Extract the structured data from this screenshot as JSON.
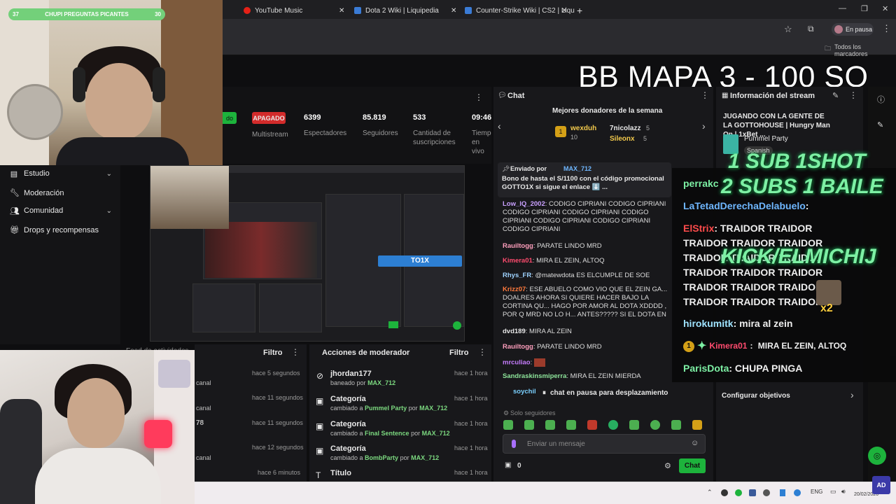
{
  "poll": {
    "left_count": "37",
    "title": "CHUPI PREGUNTAS PICANTES",
    "right_count": "30"
  },
  "browser": {
    "tabs": [
      {
        "label": "YouTube Music"
      },
      {
        "label": "Dota 2 Wiki | Liquipedia"
      },
      {
        "label": "Counter-Strike Wiki | CS2 | Liqu"
      }
    ],
    "profile_status": "En pausa",
    "bookmarks_label": "Todos los marcadores"
  },
  "overlay": {
    "headline": "BB MAPA 3 - 100 SO",
    "promo_line1": "1 SUB 1SHOT",
    "promo_line2": "2 SUBS 1 BAILE",
    "promo_kick": "KICK/ELMICHIJ",
    "multiplier": "x2"
  },
  "stats": {
    "status_partial": "do",
    "apagado_label": "APAGADO",
    "multistream_label": "Multistream",
    "items": [
      {
        "value": "6399",
        "label": "Espectadores"
      },
      {
        "value": "85.819",
        "label": "Seguidores"
      },
      {
        "value": "533",
        "label": "Cantidad de suscripciones"
      },
      {
        "value": "09:46",
        "label": "Tiempo en vivo"
      }
    ]
  },
  "sidebar": {
    "items": [
      {
        "label": "Estudio"
      },
      {
        "label": "Moderación"
      },
      {
        "label": "Comunidad"
      },
      {
        "label": "Drops y recompensas"
      }
    ]
  },
  "activity_panel": {
    "title": "Feed de actividades",
    "filter": "Filtro",
    "rows": [
      {
        "sub": "canal",
        "time": "hace 5 segundos"
      },
      {
        "sub": "canal",
        "time": "hace 11 segundos"
      },
      {
        "sub": "78",
        "time": "hace 11 segundos"
      },
      {
        "sub": "canal",
        "time": "hace 12 segundos"
      },
      {
        "sub": "canal",
        "time": "hace 6 minutos"
      }
    ]
  },
  "mod_panel": {
    "title": "Acciones de moderador",
    "filter": "Filtro",
    "rows": [
      {
        "title": "jhordan177",
        "verb": "baneado por",
        "value": "",
        "by": "MAX_712",
        "time": "hace 1 hora"
      },
      {
        "title": "Categoría",
        "verb": "cambiado a",
        "value": "Pummel Party",
        "by": "MAX_712",
        "time": "hace 1 hora"
      },
      {
        "title": "Categoría",
        "verb": "cambiado a",
        "value": "Final Sentence",
        "by": "MAX_712",
        "time": "hace 1 hora"
      },
      {
        "title": "Categoría",
        "verb": "cambiado a",
        "value": "BombParty",
        "by": "MAX_712",
        "time": "hace 1 hora"
      },
      {
        "title": "Título",
        "verb": "",
        "value": "",
        "by": "",
        "time": "hace 1 hora"
      }
    ],
    "por": "por"
  },
  "chat": {
    "title": "Chat",
    "donors_title": "Mejores donadores de la semana",
    "donors": [
      {
        "name": "wexduh",
        "amount": "10"
      },
      {
        "name": "7nicolazz",
        "amount": "5"
      },
      {
        "name": "Sileonx",
        "amount": "5"
      }
    ],
    "pinned_prefix": "Enviado por",
    "pinned_user": "MAX_712",
    "pinned_text": "Bono de hasta el S/1100 con el código promocional GOTTO1X si sigue el enlace ⬇️ ...",
    "messages": [
      {
        "user": "Low_lQ_2002",
        "color": "#c9a0ff",
        "text": "CODIGO CIPRIANI CODIGO CIPRIANI CODIGO CIPRIANI CODIGO CIPRIANI CODIGO CIPRIANI CODIGO CIPRIANI CODIGO CIPRIANI CODIGO CIPRIANI"
      },
      {
        "user": "Rauiltogg",
        "color": "#ff9fbd",
        "text": "PARATE LINDO MRD"
      },
      {
        "user": "Kimera01",
        "color": "#ff4b6e",
        "text": "MIRA EL ZEIN, ALTOQ"
      },
      {
        "user": "Rhys_FR",
        "color": "#9fd3ff",
        "text": "@matewdota ES ELCUMPLE DE SOE"
      },
      {
        "user": "Krizz07",
        "color": "#ff7a3d",
        "text": "ESE ABUELO COMO VIO QUE EL ZEIN GA... DOALRES AHORA SI QUIERE HACER BAJO LA CORTINA QU... HAGO POR AMOR AL DOTA XDDDD , POR Q MRD NO LO H... ANTES????? SI EL DOTA EN PERU TIENE BASATANTE PUBI"
      },
      {
        "user": "dvd189",
        "color": "#e8e8e8",
        "text": "MIRA AL ZEIN"
      },
      {
        "user": "Rauiltogg",
        "color": "#ff9fbd",
        "text": "PARATE LINDO MRD"
      },
      {
        "user": "mrculiao",
        "color": "#c77dff",
        "text": ""
      },
      {
        "user": "Sandraskinsmiperra",
        "color": "#8ee59b",
        "text": "MIRA EL ZEIN MIERDA"
      },
      {
        "user": "soychib",
        "color": "#7ad0ff",
        "text": ""
      }
    ],
    "paused": "chat en pausa para desplazamiento",
    "followers_only": "Solo seguidores",
    "input_placeholder": "Enviar un mensaje",
    "points": "0",
    "send_label": "Chat"
  },
  "info_panel": {
    "title": "Información del stream",
    "stream_title": "JUGANDO CON LA GENTE DE LA GOTTOHOUSE | Hungry Man On | 1xBet ...",
    "category": "Pummel Party",
    "language": "Spanish",
    "goals_label": "Configurar objetivos"
  },
  "overlay_chat": {
    "messages": [
      {
        "user": "perrakc",
        "color": "#7df0a4",
        "text": ""
      },
      {
        "user": "LaTetadDerechaDelabuelo",
        "color": "#6fb7ff",
        "text": ""
      },
      {
        "user": "ElStrix",
        "color": "#ff4b4b",
        "text": "TRAIDOR TRAIDOR TRAIDOR TRAIDOR TRAIDOR TRAIDOR TRAIDOR TRAIDOR TRAIDOR TRAIDOR TRAIDOR TRAIDOR TRAIDOR TRAIDOR TRAIDOR TRAIDOR TRAIDOR TRAIDOR"
      },
      {
        "user": "hirokumitk",
        "color": "#9fe3ff",
        "text": "mira al zein"
      },
      {
        "user": "Kimera01",
        "color": "#ff4b6e",
        "text": "MIRA EL ZEIN, ALTOQ"
      },
      {
        "user": "ParisDota",
        "color": "#7df0a4",
        "text": "CHUPA PINGA"
      }
    ]
  },
  "taskbar": {
    "lang": "ENG",
    "date": "20/02/2026"
  },
  "colors": {
    "accent_green": "#1db33c",
    "danger_red": "#d22b2b",
    "neon_green": "#7df0a4"
  }
}
